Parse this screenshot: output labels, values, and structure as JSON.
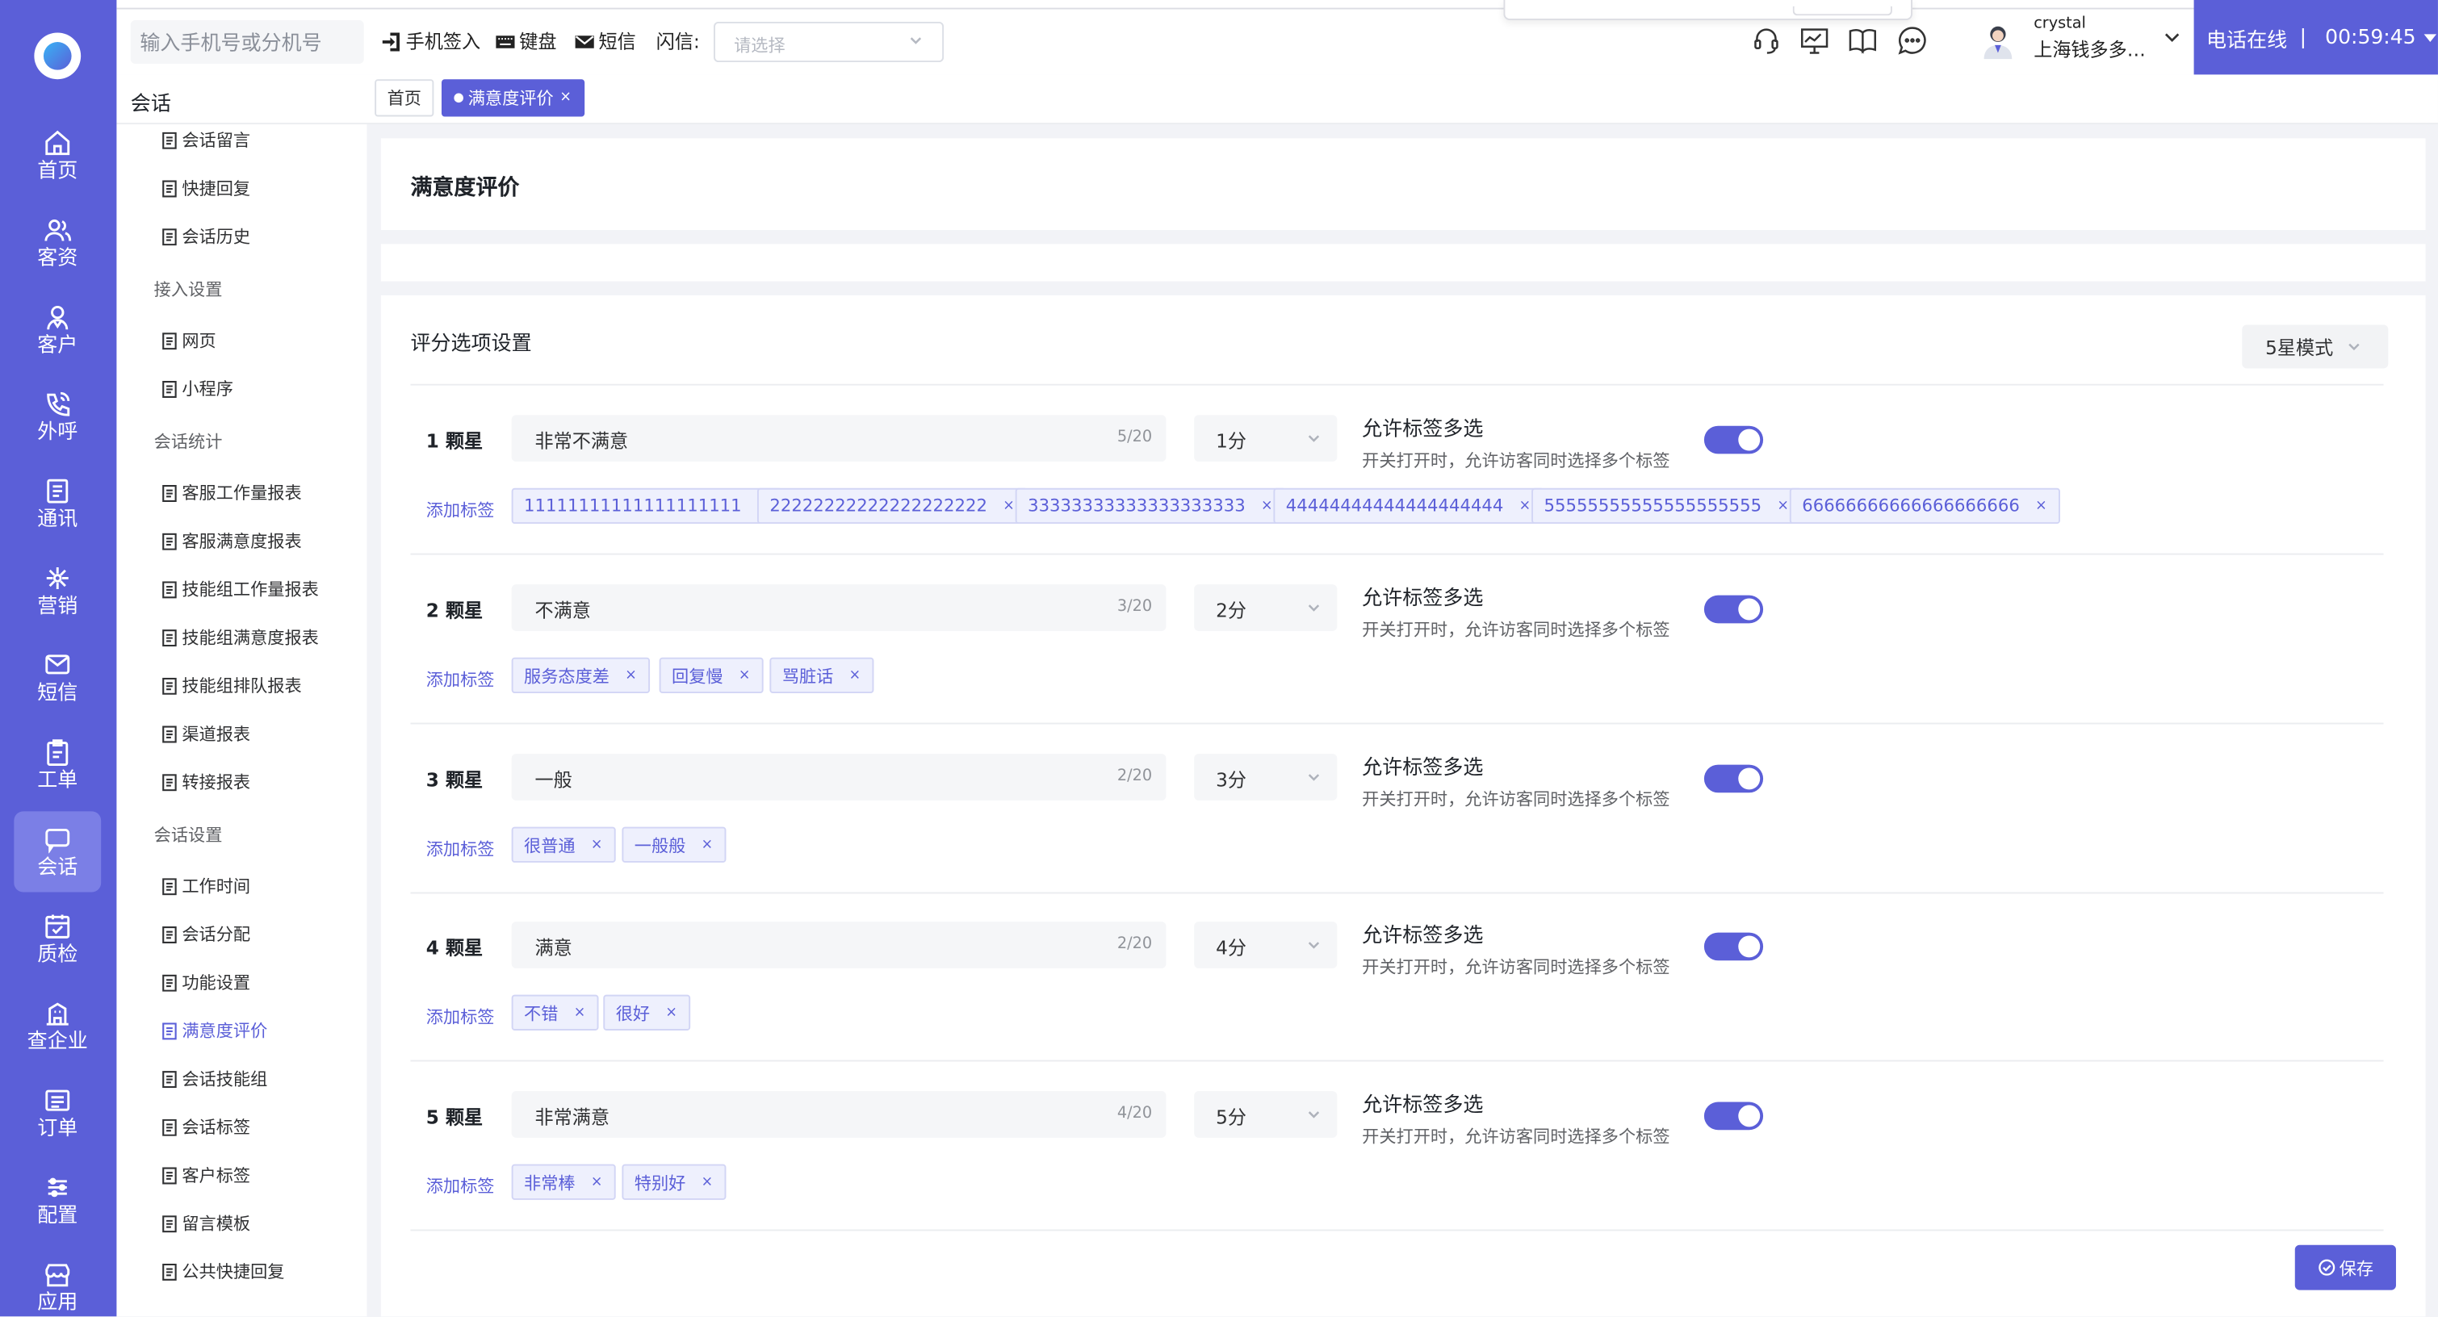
{
  "nav": {
    "items": [
      {
        "label": "首页",
        "icon": "home-icon"
      },
      {
        "label": "客资",
        "icon": "users-icon"
      },
      {
        "label": "客户",
        "icon": "customer-icon"
      },
      {
        "label": "外呼",
        "icon": "phone-call-icon"
      },
      {
        "label": "通讯",
        "icon": "contacts-icon"
      },
      {
        "label": "营销",
        "icon": "marketing-icon"
      },
      {
        "label": "短信",
        "icon": "sms-icon"
      },
      {
        "label": "工单",
        "icon": "clipboard-icon"
      },
      {
        "label": "会话",
        "icon": "chat-icon"
      },
      {
        "label": "质检",
        "icon": "inspection-icon"
      },
      {
        "label": "查企业",
        "icon": "company-icon"
      },
      {
        "label": "订单",
        "icon": "order-icon"
      },
      {
        "label": "配置",
        "icon": "settings-sliders-icon"
      },
      {
        "label": "应用",
        "icon": "app-store-icon"
      }
    ],
    "active_index": 8
  },
  "topbar": {
    "search_placeholder": "输入手机号或分机号",
    "phone_signin": "手机签入",
    "keyboard": "键盘",
    "sms": "短信",
    "flash_label": "闪信:",
    "flash_placeholder": "请选择",
    "username": "crystal",
    "company": "上海钱多多功能测试",
    "phone_status": "电话在线",
    "timer": "00:59:45"
  },
  "subside": {
    "title": "会话",
    "items": [
      {
        "type": "item",
        "label": "会话留言"
      },
      {
        "type": "item",
        "label": "快捷回复"
      },
      {
        "type": "item",
        "label": "会话历史"
      },
      {
        "type": "group",
        "label": "接入设置"
      },
      {
        "type": "item",
        "label": "网页"
      },
      {
        "type": "item",
        "label": "小程序"
      },
      {
        "type": "group",
        "label": "会话统计"
      },
      {
        "type": "item",
        "label": "客服工作量报表"
      },
      {
        "type": "item",
        "label": "客服满意度报表"
      },
      {
        "type": "item",
        "label": "技能组工作量报表"
      },
      {
        "type": "item",
        "label": "技能组满意度报表"
      },
      {
        "type": "item",
        "label": "技能组排队报表"
      },
      {
        "type": "item",
        "label": "渠道报表"
      },
      {
        "type": "item",
        "label": "转接报表"
      },
      {
        "type": "group",
        "label": "会话设置"
      },
      {
        "type": "item",
        "label": "工作时间"
      },
      {
        "type": "item",
        "label": "会话分配"
      },
      {
        "type": "item",
        "label": "功能设置"
      },
      {
        "type": "item",
        "label": "满意度评价",
        "active": true
      },
      {
        "type": "item",
        "label": "会话技能组"
      },
      {
        "type": "item",
        "label": "会话标签"
      },
      {
        "type": "item",
        "label": "客户标签"
      },
      {
        "type": "item",
        "label": "留言模板"
      },
      {
        "type": "item",
        "label": "公共快捷回复"
      }
    ]
  },
  "tabs": [
    {
      "label": "首页",
      "active": false
    },
    {
      "label": "满意度评价",
      "active": true,
      "close": "×"
    }
  ],
  "main": {
    "page_title": "满意度评价",
    "section_title": "评分选项设置",
    "mode": "5星模式",
    "multi_title": "允许标签多选",
    "multi_desc": "开关打开时，允许访客同时选择多个标签",
    "add_tag": "添加标签",
    "tag_close": "×",
    "save": "保存",
    "rows": [
      {
        "star": "1 颗星",
        "desc": "非常不满意",
        "count": "5/20",
        "score": "1分",
        "multi": true,
        "tags": [
          "11111111111111111111",
          "22222222222222222222",
          "33333333333333333333",
          "44444444444444444444",
          "55555555555555555555",
          "66666666666666666666"
        ]
      },
      {
        "star": "2 颗星",
        "desc": "不满意",
        "count": "3/20",
        "score": "2分",
        "multi": true,
        "tags": [
          "服务态度差",
          "回复慢",
          "骂脏话"
        ]
      },
      {
        "star": "3 颗星",
        "desc": "一般",
        "count": "2/20",
        "score": "3分",
        "multi": true,
        "tags": [
          "很普通",
          "一般般"
        ]
      },
      {
        "star": "4 颗星",
        "desc": "满意",
        "count": "2/20",
        "score": "4分",
        "multi": true,
        "tags": [
          "不错",
          "很好"
        ]
      },
      {
        "star": "5 颗星",
        "desc": "非常满意",
        "count": "4/20",
        "score": "5分",
        "multi": true,
        "tags": [
          "非常棒",
          "特别好"
        ]
      }
    ]
  },
  "colors": {
    "accent": "#5b5fd8",
    "tag_bg": "#eef0fd"
  }
}
